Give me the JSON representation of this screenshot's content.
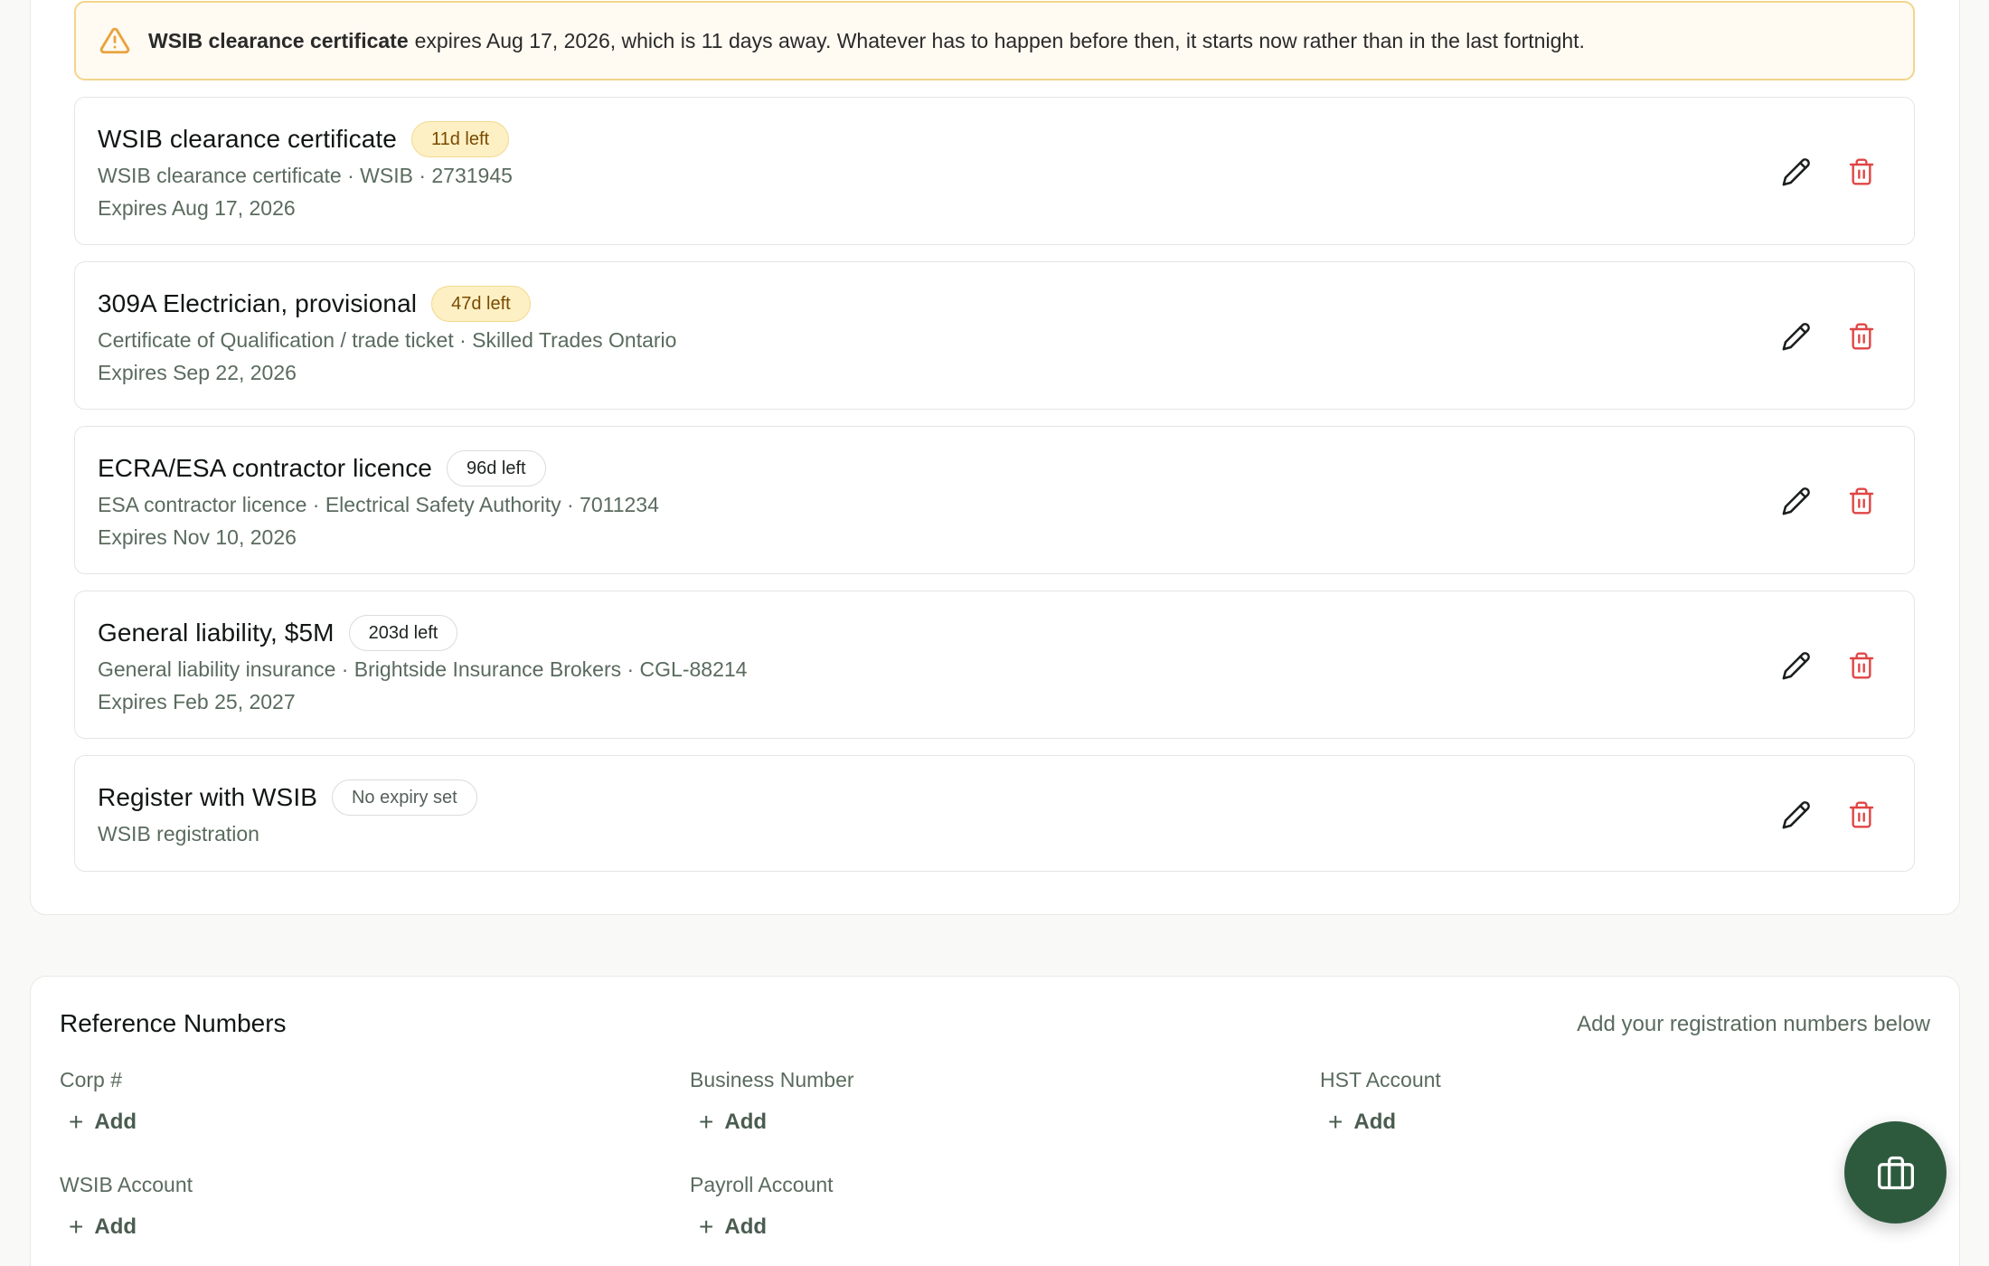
{
  "alert": {
    "bold": "WSIB clearance certificate",
    "text": "expires Aug 17, 2026, which is 11 days away. Whatever has to happen before then, it starts now rather than in the last fortnight."
  },
  "cards": [
    {
      "title": "WSIB clearance certificate",
      "badge": "11d left",
      "subtitle": "WSIB clearance certificate · WSIB · 2731945",
      "expires": "Expires Aug 17, 2026"
    },
    {
      "title": "309A Electrician, provisional",
      "badge": "47d left",
      "subtitle": "Certificate of Qualification / trade ticket · Skilled Trades Ontario",
      "expires": "Expires Sep 22, 2026"
    },
    {
      "title": "ECRA/ESA contractor licence",
      "badge": "96d left",
      "subtitle": "ESA contractor licence · Electrical Safety Authority · 7011234",
      "expires": "Expires Nov 10, 2026"
    },
    {
      "title": "General liability, $5M",
      "badge": "203d left",
      "subtitle": "General liability insurance · Brightside Insurance Brokers · CGL-88214",
      "expires": "Expires Feb 25, 2027"
    },
    {
      "title": "Register with WSIB",
      "badge": "No expiry set",
      "subtitle": "WSIB registration",
      "expires": ""
    }
  ],
  "reference": {
    "title": "Reference Numbers",
    "hint": "Add your registration numbers below",
    "add_label": "Add",
    "fields": [
      {
        "label": "Corp #"
      },
      {
        "label": "Business Number"
      },
      {
        "label": "HST Account"
      },
      {
        "label": "WSIB Account"
      },
      {
        "label": "Payroll Account"
      }
    ]
  },
  "colors": {
    "warning_accent": "#e8a33d",
    "delete_red": "#e04545",
    "fab_green": "#2d5a3d"
  },
  "icons": {
    "alert": "warning-triangle-icon",
    "edit": "pencil-icon",
    "delete": "trash-icon",
    "fab": "briefcase-icon"
  }
}
